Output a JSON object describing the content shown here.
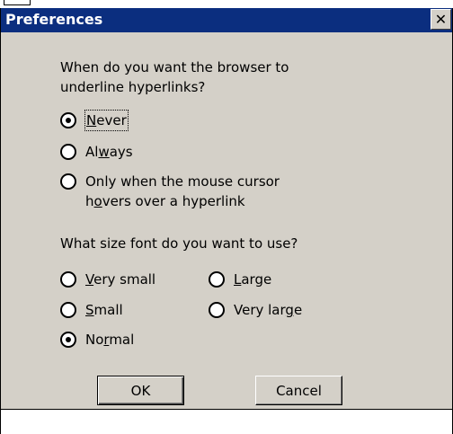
{
  "window": {
    "title": "Preferences",
    "close_symbol": "✕"
  },
  "underline_section": {
    "question_line1": "When do you want the browser to",
    "question_line2": "underline hyperlinks?",
    "options": [
      {
        "label_pre": "",
        "label_u": "N",
        "label_post": "ever",
        "checked": true
      },
      {
        "label_pre": "Al",
        "label_u": "w",
        "label_post": "ays",
        "checked": false
      },
      {
        "label_line1": "Only when the mouse cursor",
        "label_line2_pre": "h",
        "label_line2_u": "o",
        "label_line2_post": "vers over a hyperlink",
        "checked": false
      }
    ]
  },
  "font_section": {
    "question": "What size font do you want to use?",
    "options": [
      {
        "label_pre": "",
        "label_u": "V",
        "label_post": "ery small",
        "checked": false
      },
      {
        "label_pre": "",
        "label_u": "L",
        "label_post": "arge",
        "checked": false
      },
      {
        "label_pre": "",
        "label_u": "S",
        "label_post": "mall",
        "checked": false
      },
      {
        "label_pre": "Very lar",
        "label_u": "g",
        "label_post": "e",
        "checked": false
      },
      {
        "label_pre": "No",
        "label_u": "r",
        "label_post": "mal",
        "checked": true
      }
    ]
  },
  "buttons": {
    "ok": "OK",
    "cancel": "Cancel"
  }
}
